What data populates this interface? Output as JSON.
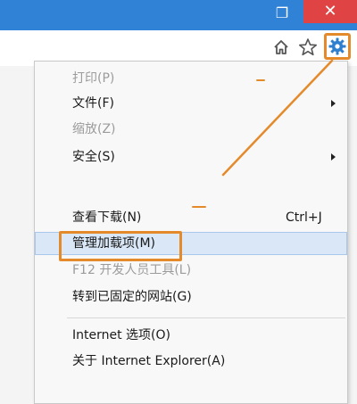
{
  "window": {
    "restore_glyph": "❐",
    "close_glyph": "✕"
  },
  "toolbar": {
    "home_icon": "home-icon",
    "favorites_icon": "star-icon",
    "tools_icon": "gear-icon"
  },
  "menu": {
    "items": [
      {
        "label": "打印(P)",
        "disabled": true
      },
      {
        "label": "文件(F)",
        "submenu": true
      },
      {
        "label": "缩放(Z)",
        "disabled": true
      },
      {
        "label": "安全(S)",
        "submenu": true
      },
      {
        "label": "查看下载(N)",
        "shortcut": "Ctrl+J"
      },
      {
        "label": "管理加载项(M)",
        "highlighted": true
      },
      {
        "label": "F12 开发人员工具(L)",
        "disabled": true
      },
      {
        "label": "转到已固定的网站(G)"
      },
      {
        "label": "Internet 选项(O)"
      },
      {
        "label": "关于 Internet Explorer(A)"
      }
    ]
  },
  "colors": {
    "accent_highlight": "#e58a2b",
    "titlebar": "#2f82d6",
    "close": "#e04343",
    "hover": "#d9e7f7"
  }
}
